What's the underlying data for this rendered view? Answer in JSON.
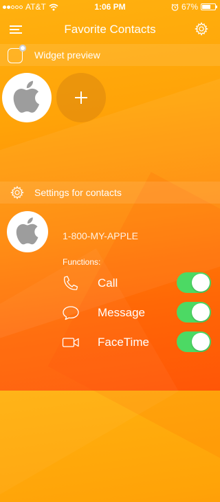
{
  "status_bar": {
    "carrier": "AT&T",
    "signal_bars_filled": 2,
    "signal_bars_total": 5,
    "time": "1:06 PM",
    "battery_percent": "67%",
    "battery_level": 0.67
  },
  "nav": {
    "title": "Favorite Contacts",
    "menu_icon": "hamburger-menu-icon",
    "settings_icon": "gear-icon"
  },
  "widget_section": {
    "label": "Widget preview",
    "icon": "widget-icon"
  },
  "settings_section": {
    "label": "Settings for contacts",
    "icon": "gear-icon"
  },
  "contact": {
    "number": "1-800-MY-APPLE",
    "avatar_icon": "apple-logo-icon"
  },
  "functions": {
    "label": "Functions:",
    "items": [
      {
        "label": "Call",
        "icon": "phone-icon",
        "enabled": true
      },
      {
        "label": "Message",
        "icon": "message-bubble-icon",
        "enabled": true
      },
      {
        "label": "FaceTime",
        "icon": "video-camera-icon",
        "enabled": true
      }
    ]
  },
  "colors": {
    "background_top": "#ffb10f",
    "background_bottom": "#ff5a08",
    "toggle_on": "#4cd964",
    "text": "#ffffff"
  }
}
